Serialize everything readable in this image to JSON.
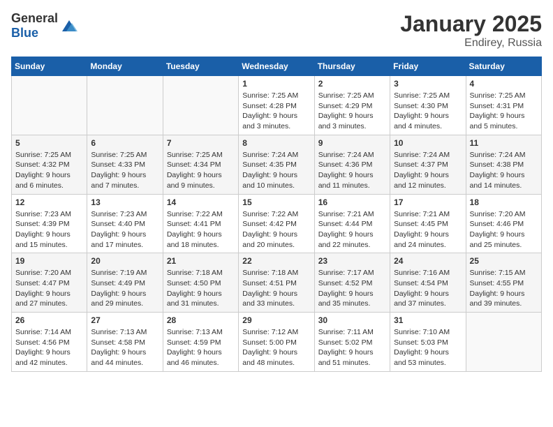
{
  "header": {
    "logo_general": "General",
    "logo_blue": "Blue",
    "title": "January 2025",
    "subtitle": "Endirey, Russia"
  },
  "days_of_week": [
    "Sunday",
    "Monday",
    "Tuesday",
    "Wednesday",
    "Thursday",
    "Friday",
    "Saturday"
  ],
  "weeks": [
    [
      {
        "day": "",
        "info": ""
      },
      {
        "day": "",
        "info": ""
      },
      {
        "day": "",
        "info": ""
      },
      {
        "day": "1",
        "info": "Sunrise: 7:25 AM\nSunset: 4:28 PM\nDaylight: 9 hours and 3 minutes."
      },
      {
        "day": "2",
        "info": "Sunrise: 7:25 AM\nSunset: 4:29 PM\nDaylight: 9 hours and 3 minutes."
      },
      {
        "day": "3",
        "info": "Sunrise: 7:25 AM\nSunset: 4:30 PM\nDaylight: 9 hours and 4 minutes."
      },
      {
        "day": "4",
        "info": "Sunrise: 7:25 AM\nSunset: 4:31 PM\nDaylight: 9 hours and 5 minutes."
      }
    ],
    [
      {
        "day": "5",
        "info": "Sunrise: 7:25 AM\nSunset: 4:32 PM\nDaylight: 9 hours and 6 minutes."
      },
      {
        "day": "6",
        "info": "Sunrise: 7:25 AM\nSunset: 4:33 PM\nDaylight: 9 hours and 7 minutes."
      },
      {
        "day": "7",
        "info": "Sunrise: 7:25 AM\nSunset: 4:34 PM\nDaylight: 9 hours and 9 minutes."
      },
      {
        "day": "8",
        "info": "Sunrise: 7:24 AM\nSunset: 4:35 PM\nDaylight: 9 hours and 10 minutes."
      },
      {
        "day": "9",
        "info": "Sunrise: 7:24 AM\nSunset: 4:36 PM\nDaylight: 9 hours and 11 minutes."
      },
      {
        "day": "10",
        "info": "Sunrise: 7:24 AM\nSunset: 4:37 PM\nDaylight: 9 hours and 12 minutes."
      },
      {
        "day": "11",
        "info": "Sunrise: 7:24 AM\nSunset: 4:38 PM\nDaylight: 9 hours and 14 minutes."
      }
    ],
    [
      {
        "day": "12",
        "info": "Sunrise: 7:23 AM\nSunset: 4:39 PM\nDaylight: 9 hours and 15 minutes."
      },
      {
        "day": "13",
        "info": "Sunrise: 7:23 AM\nSunset: 4:40 PM\nDaylight: 9 hours and 17 minutes."
      },
      {
        "day": "14",
        "info": "Sunrise: 7:22 AM\nSunset: 4:41 PM\nDaylight: 9 hours and 18 minutes."
      },
      {
        "day": "15",
        "info": "Sunrise: 7:22 AM\nSunset: 4:42 PM\nDaylight: 9 hours and 20 minutes."
      },
      {
        "day": "16",
        "info": "Sunrise: 7:21 AM\nSunset: 4:44 PM\nDaylight: 9 hours and 22 minutes."
      },
      {
        "day": "17",
        "info": "Sunrise: 7:21 AM\nSunset: 4:45 PM\nDaylight: 9 hours and 24 minutes."
      },
      {
        "day": "18",
        "info": "Sunrise: 7:20 AM\nSunset: 4:46 PM\nDaylight: 9 hours and 25 minutes."
      }
    ],
    [
      {
        "day": "19",
        "info": "Sunrise: 7:20 AM\nSunset: 4:47 PM\nDaylight: 9 hours and 27 minutes."
      },
      {
        "day": "20",
        "info": "Sunrise: 7:19 AM\nSunset: 4:49 PM\nDaylight: 9 hours and 29 minutes."
      },
      {
        "day": "21",
        "info": "Sunrise: 7:18 AM\nSunset: 4:50 PM\nDaylight: 9 hours and 31 minutes."
      },
      {
        "day": "22",
        "info": "Sunrise: 7:18 AM\nSunset: 4:51 PM\nDaylight: 9 hours and 33 minutes."
      },
      {
        "day": "23",
        "info": "Sunrise: 7:17 AM\nSunset: 4:52 PM\nDaylight: 9 hours and 35 minutes."
      },
      {
        "day": "24",
        "info": "Sunrise: 7:16 AM\nSunset: 4:54 PM\nDaylight: 9 hours and 37 minutes."
      },
      {
        "day": "25",
        "info": "Sunrise: 7:15 AM\nSunset: 4:55 PM\nDaylight: 9 hours and 39 minutes."
      }
    ],
    [
      {
        "day": "26",
        "info": "Sunrise: 7:14 AM\nSunset: 4:56 PM\nDaylight: 9 hours and 42 minutes."
      },
      {
        "day": "27",
        "info": "Sunrise: 7:13 AM\nSunset: 4:58 PM\nDaylight: 9 hours and 44 minutes."
      },
      {
        "day": "28",
        "info": "Sunrise: 7:13 AM\nSunset: 4:59 PM\nDaylight: 9 hours and 46 minutes."
      },
      {
        "day": "29",
        "info": "Sunrise: 7:12 AM\nSunset: 5:00 PM\nDaylight: 9 hours and 48 minutes."
      },
      {
        "day": "30",
        "info": "Sunrise: 7:11 AM\nSunset: 5:02 PM\nDaylight: 9 hours and 51 minutes."
      },
      {
        "day": "31",
        "info": "Sunrise: 7:10 AM\nSunset: 5:03 PM\nDaylight: 9 hours and 53 minutes."
      },
      {
        "day": "",
        "info": ""
      }
    ]
  ]
}
